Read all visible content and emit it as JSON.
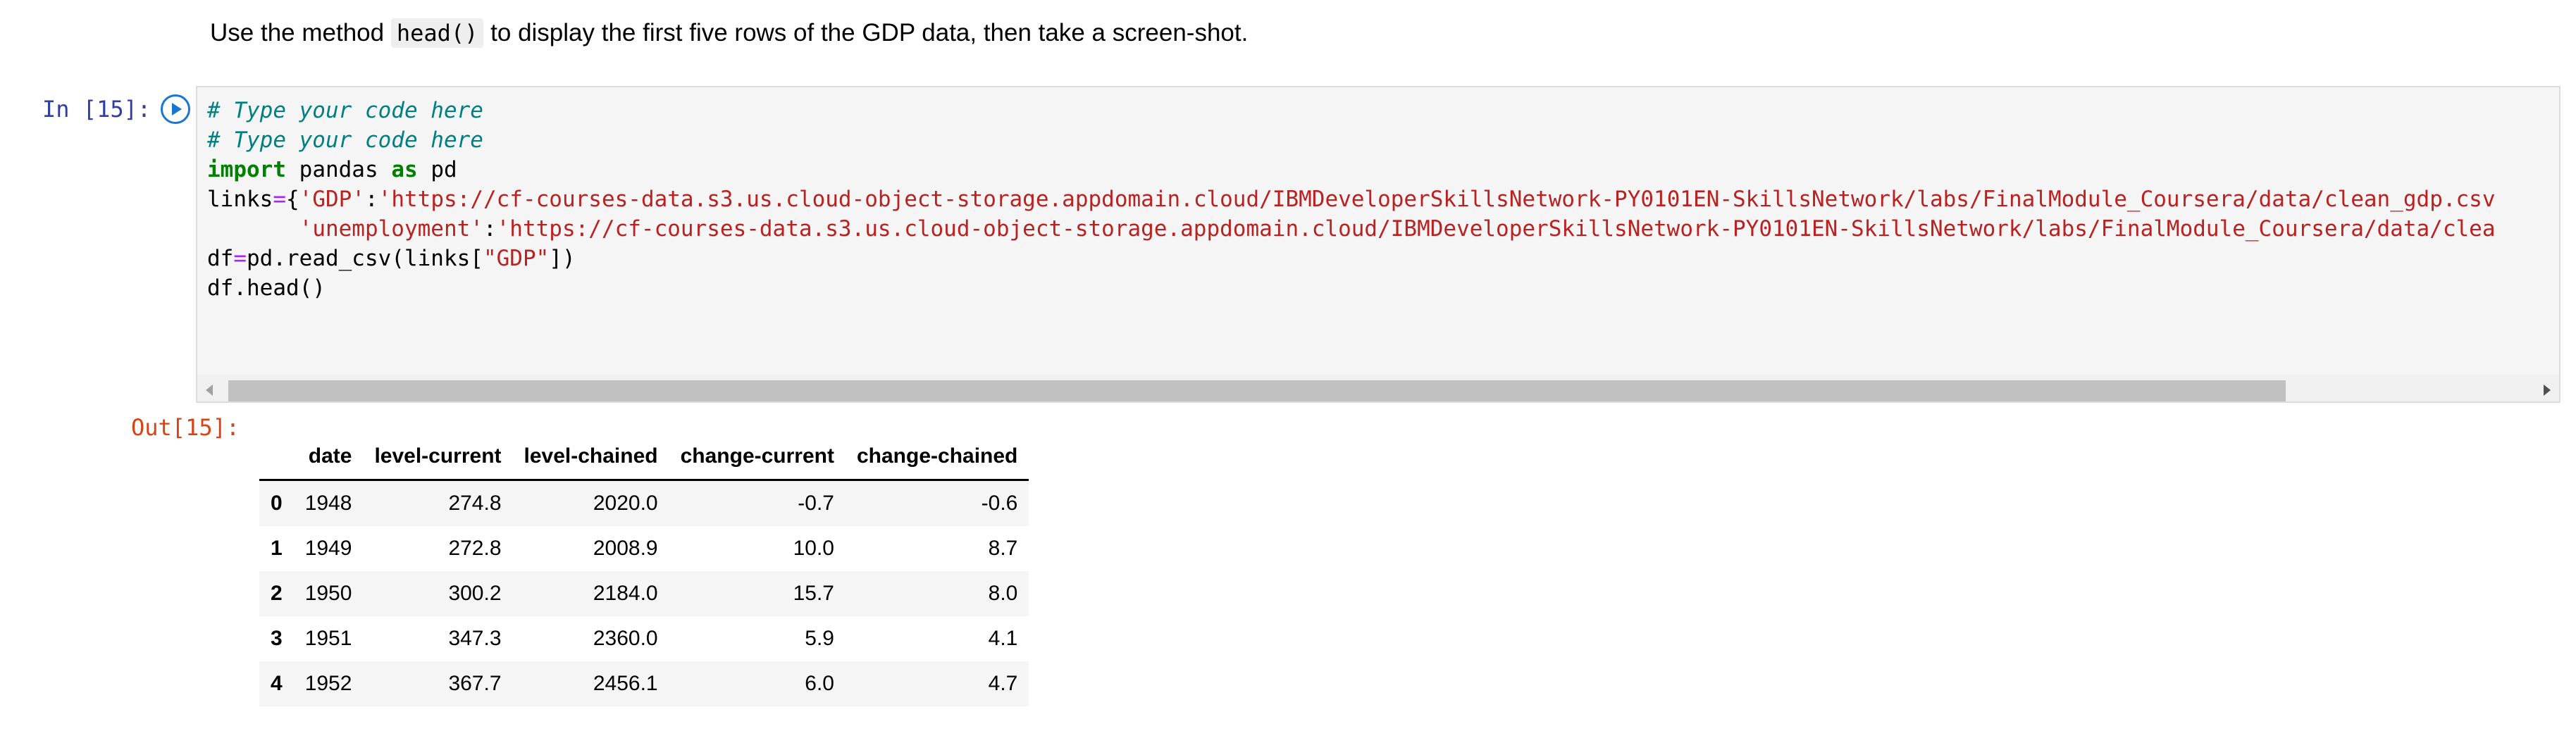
{
  "markdown": {
    "text_before": "Use the method",
    "code": "head()",
    "text_after": "to display the first five rows of the GDP data, then take a screen-shot."
  },
  "input_cell": {
    "prompt": "In [15]:",
    "run_icon": "run-cell-icon",
    "code_lines": {
      "comment1": "# Type your code here",
      "comment2": "# Type your code here",
      "kw_import": "import",
      "module": "pandas",
      "kw_as": "as",
      "alias": "pd",
      "links_assign": "links",
      "eq1": "=",
      "brace_open": "{",
      "gdp_key": "'GDP'",
      "colon1": ":",
      "gdp_url": "'https://cf-courses-data.s3.us.cloud-object-storage.appdomain.cloud/IBMDeveloperSkillsNetwork-PY0101EN-SkillsNetwork/labs/FinalModule_Coursera/data/clean_gdp.csv",
      "unemp_indent": "       ",
      "unemp_key": "'unemployment'",
      "colon2": ":",
      "unemp_url": "'https://cf-courses-data.s3.us.cloud-object-storage.appdomain.cloud/IBMDeveloperSkillsNetwork-PY0101EN-SkillsNetwork/labs/FinalModule_Coursera/data/clea",
      "df_assign": "df",
      "eq2": "=",
      "read_call": "pd.read_csv(links[",
      "gdp_str": "\"GDP\"",
      "read_close": "])",
      "head_call": "df.head()"
    }
  },
  "output_cell": {
    "prompt": "Out[15]:",
    "table": {
      "columns": [
        "",
        "date",
        "level-current",
        "level-chained",
        "change-current",
        "change-chained"
      ],
      "rows": [
        [
          "0",
          "1948",
          "274.8",
          "2020.0",
          "-0.7",
          "-0.6"
        ],
        [
          "1",
          "1949",
          "272.8",
          "2008.9",
          "10.0",
          "8.7"
        ],
        [
          "2",
          "1950",
          "300.2",
          "2184.0",
          "15.7",
          "8.0"
        ],
        [
          "3",
          "1951",
          "347.3",
          "2360.0",
          "5.9",
          "4.1"
        ],
        [
          "4",
          "1952",
          "367.7",
          "2456.1",
          "6.0",
          "4.7"
        ]
      ]
    }
  }
}
